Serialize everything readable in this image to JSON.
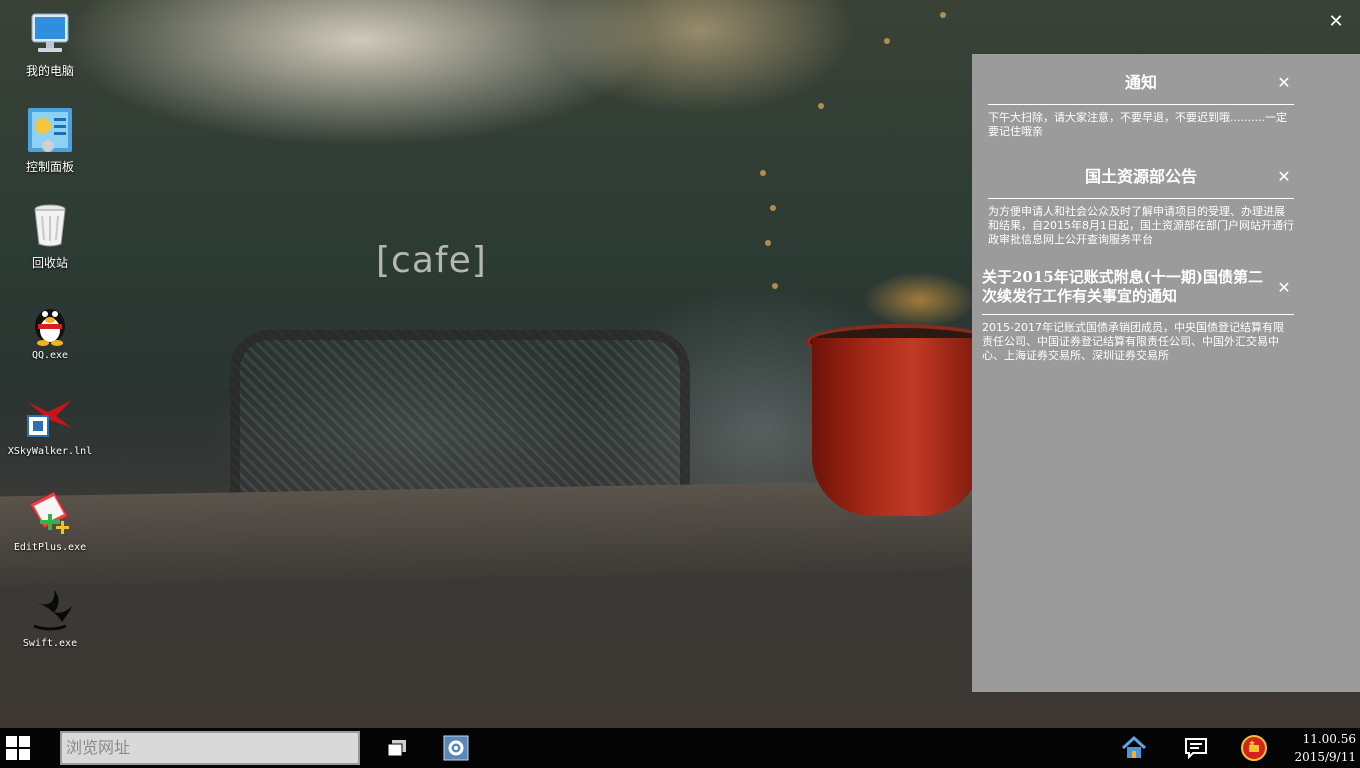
{
  "wallpaper": {
    "text": "[cafe]"
  },
  "desktop_icons": [
    {
      "label": "我的电脑",
      "icon": "computer-icon"
    },
    {
      "label": "控制面板",
      "icon": "control-panel-icon"
    },
    {
      "label": "回收站",
      "icon": "recycle-bin-icon"
    },
    {
      "label": "QQ.exe",
      "icon": "qq-penguin-icon"
    },
    {
      "label": "XSkyWalker.lnl",
      "icon": "xskywalker-icon"
    },
    {
      "label": "EditPlus.exe",
      "icon": "editplus-icon"
    },
    {
      "label": "Swift.exe",
      "icon": "swift-bird-icon"
    }
  ],
  "top_close": {
    "symbol": "✕"
  },
  "notifications": [
    {
      "title": "通知",
      "body": "下午大扫除，请大家注意，不要早退，不要迟到哦..........一定要记住哦亲",
      "close": "✕"
    },
    {
      "title": "国土资源部公告",
      "body": "为方便申请人和社会公众及时了解申请项目的受理、办理进展和结果，自2015年8月1日起，国土资源部在部门户网站开通行政审批信息网上公开查询服务平台",
      "close": "✕"
    },
    {
      "title": "关于2015年记账式附息(十一期)国债第二次续发行工作有关事宜的通知",
      "body": "2015-2017年记账式国债承销团成员，中央国债登记结算有限责任公司、中国证券登记结算有限责任公司、中国外汇交易中心、上海证券交易所、深圳证券交易所",
      "close": "✕"
    }
  ],
  "taskbar": {
    "search_placeholder": "浏览网址",
    "clock_time": "11.00.56",
    "clock_date": "2015/9/11"
  },
  "colors": {
    "panel": "#9b9b9b",
    "taskbar": "#050505",
    "search_bg": "#d9d9d9"
  }
}
